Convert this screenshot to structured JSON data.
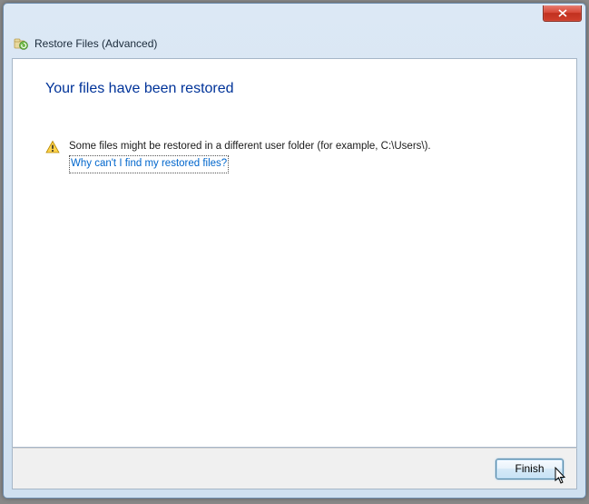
{
  "window": {
    "title": "Restore Files (Advanced)"
  },
  "content": {
    "heading": "Your files have been restored",
    "warning_text": "Some files might be restored in a different user folder (for example, C:\\Users\\).",
    "help_link_text": "Why can't I find my restored files?"
  },
  "footer": {
    "finish_label": "Finish"
  }
}
